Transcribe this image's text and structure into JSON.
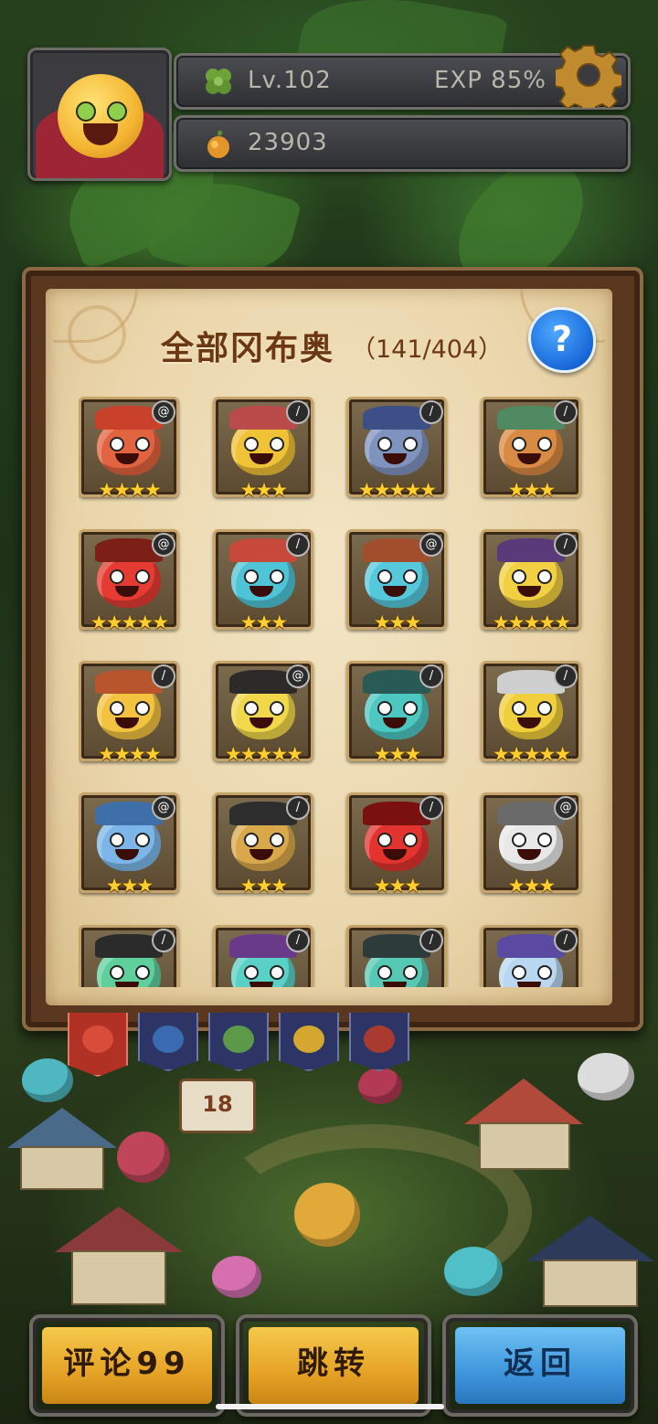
{
  "hud": {
    "level": "Lv.102",
    "exp": "EXP  85%",
    "coins": "23903"
  },
  "panel": {
    "title": "全部冈布奥",
    "count": "（141/404）",
    "help": "?"
  },
  "monsters": [
    {
      "color": "#e2633f",
      "hat": "#c9402b",
      "stars": "★★★★",
      "elem": "@"
    },
    {
      "color": "#f0c236",
      "hat": "#b94b4b",
      "stars": "★★★",
      "elem": "/"
    },
    {
      "color": "#7f93bf",
      "hat": "#3c4f86",
      "stars": "★★★★★",
      "elem": "/"
    },
    {
      "color": "#d98a43",
      "hat": "#4f8a62",
      "stars": "★★★",
      "elem": "/"
    },
    {
      "color": "#e53b33",
      "hat": "#7b1f17",
      "stars": "★★★★★",
      "elem": "@"
    },
    {
      "color": "#4fc4d6",
      "hat": "#c7493b",
      "stars": "★★★",
      "elem": "/"
    },
    {
      "color": "#56c8dc",
      "hat": "#a24d2b",
      "stars": "★★★",
      "elem": "@"
    },
    {
      "color": "#f2d041",
      "hat": "#5b3a7a",
      "stars": "★★★★★",
      "elem": "/"
    },
    {
      "color": "#f2c240",
      "hat": "#b9552d",
      "stars": "★★★★",
      "elem": "/"
    },
    {
      "color": "#f1d74a",
      "hat": "#2e2a2a",
      "stars": "★★★★★",
      "elem": "@"
    },
    {
      "color": "#4cc7c2",
      "hat": "#2a5a56",
      "stars": "★★★",
      "elem": "/"
    },
    {
      "color": "#f0ce3c",
      "hat": "#cfcfcf",
      "stars": "★★★★★",
      "elem": "/"
    },
    {
      "color": "#7cb6e8",
      "hat": "#3f6fa8",
      "stars": "★★★",
      "elem": "@"
    },
    {
      "color": "#d9a84a",
      "hat": "#2d2d2d",
      "stars": "★★★",
      "elem": "/"
    },
    {
      "color": "#e2332f",
      "hat": "#7a1010",
      "stars": "★★★",
      "elem": "/"
    },
    {
      "color": "#e8e8e8",
      "hat": "#6a6a6a",
      "stars": "★★★",
      "elem": "@"
    },
    {
      "color": "#5fcf9c",
      "hat": "#2b2b2b",
      "stars": "",
      "elem": "/"
    },
    {
      "color": "#5ad1c6",
      "hat": "#6a3a8a",
      "stars": "",
      "elem": "/"
    },
    {
      "color": "#55c9b4",
      "hat": "#2e3b3b",
      "stars": "",
      "elem": "/"
    },
    {
      "color": "#b9d7f0",
      "hat": "#5a4aa0",
      "stars": "",
      "elem": "/"
    }
  ],
  "tabs": [
    {
      "name": "all",
      "color": "#d94c3a"
    },
    {
      "name": "blue",
      "color": "#3a6bb0"
    },
    {
      "name": "green",
      "color": "#5c9a4a"
    },
    {
      "name": "gold",
      "color": "#d6a72f"
    },
    {
      "name": "red",
      "color": "#a83a2f"
    }
  ],
  "sign_number": "18",
  "buttons": {
    "comment": "评论99",
    "jump": "跳转",
    "back": "返回"
  }
}
